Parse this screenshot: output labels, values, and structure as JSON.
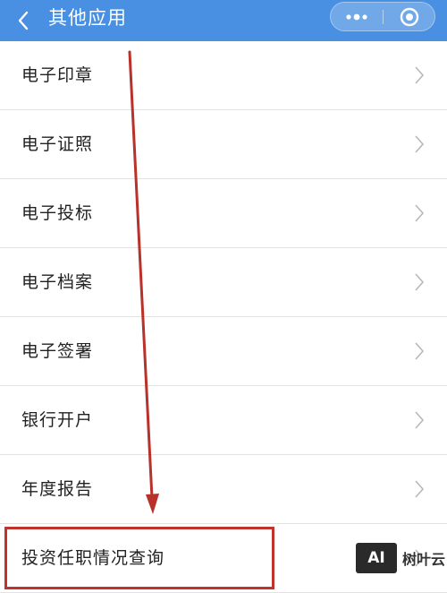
{
  "header": {
    "title": "其他应用",
    "background_color": "#4a90e2",
    "back_icon": "chevron-left-icon",
    "more_icon": "more-dots-icon",
    "target_icon": "target-circle-icon"
  },
  "list": {
    "items": [
      {
        "label": "电子印章"
      },
      {
        "label": "电子证照"
      },
      {
        "label": "电子投标"
      },
      {
        "label": "电子档案"
      },
      {
        "label": "电子签署"
      },
      {
        "label": "银行开户"
      },
      {
        "label": "年度报告"
      },
      {
        "label": "投资任职情况查询"
      }
    ],
    "chevron_icon": "chevron-right-icon"
  },
  "annotation": {
    "arrow_color": "#b8312b",
    "highlight_color": "#c0332c"
  },
  "watermark": {
    "logo_text": "AI",
    "text": "树叶云"
  }
}
